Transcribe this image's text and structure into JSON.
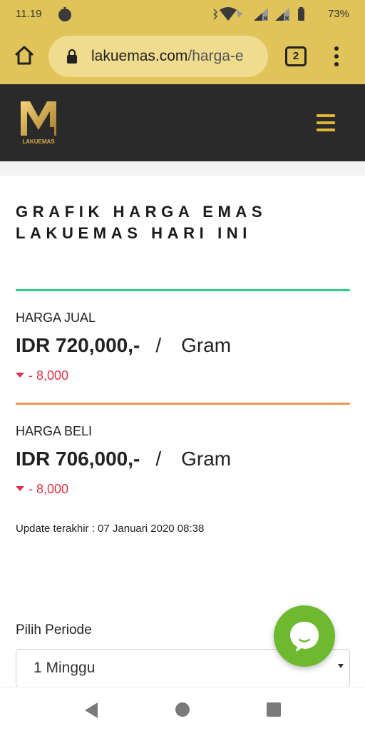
{
  "status_bar": {
    "time": "11.19",
    "battery": "73%",
    "icons": [
      "notification-icon",
      "vibrate-icon",
      "wifi-icon",
      "signal-icon",
      "signal-icon",
      "battery-icon"
    ]
  },
  "browser": {
    "url_domain": "lakuemas.com",
    "url_path": "/harga-e",
    "tab_count": "2",
    "icons": [
      "home-icon",
      "lock-icon",
      "overflow-menu-icon"
    ]
  },
  "site": {
    "logo_text": "LAKUEMAS",
    "icons": [
      "hamburger-icon"
    ]
  },
  "page": {
    "title_line1": "GRAFIK HARGA EMAS",
    "title_line2": "LAKUEMAS HARI INI"
  },
  "sell": {
    "label": "HARGA JUAL",
    "amount": "IDR 720,000,-",
    "separator": "/",
    "unit": "Gram",
    "change": "- 8,000"
  },
  "buy": {
    "label": "HARGA BELI",
    "amount": "IDR 706,000,-",
    "separator": "/",
    "unit": "Gram",
    "change": "- 8,000"
  },
  "update_text": "Update terakhir : 07 Januari 2020 08:38",
  "period": {
    "label": "Pilih Periode",
    "selected": "1 Minggu"
  },
  "colors": {
    "accent_gold": "#e0c45a",
    "header_dark": "#2a2a2a",
    "sell_rule": "#2fd18a",
    "buy_rule": "#f0964e",
    "decrease_red": "#d9344a",
    "chat_green": "#6db92f"
  }
}
